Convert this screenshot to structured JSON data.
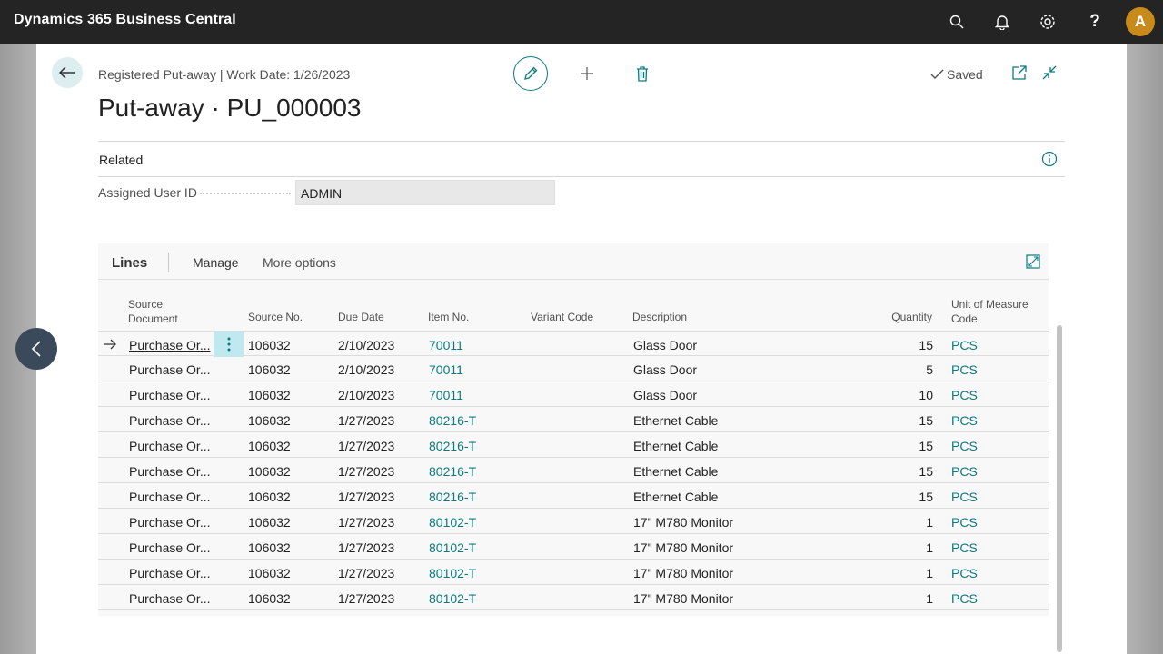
{
  "app": {
    "title": "Dynamics 365 Business Central",
    "avatar_initial": "A"
  },
  "icons": {
    "search": "search-icon",
    "bell": "bell-icon",
    "settings": "gear-icon",
    "help": "help-icon",
    "back": "back-arrow-icon",
    "edit": "pencil-icon",
    "add": "plus-icon",
    "delete": "trash-icon",
    "saved": "checkmark-icon",
    "open_new": "open-new-window-icon",
    "collapse": "collapse-icon",
    "info": "info-icon",
    "expand": "expand-icon",
    "row_arrow": "right-arrow-icon",
    "row_menu": "more-vertical-icon",
    "side_nav": "chevron-left-icon"
  },
  "colors": {
    "accent": "#0b7a80",
    "appbar": "#242424",
    "avatar": "#c88a1b"
  },
  "header": {
    "breadcrumb": "Registered Put-away | Work Date: 1/26/2023",
    "title": "Put-away · PU_000003",
    "saved_label": "Saved"
  },
  "related": {
    "label": "Related"
  },
  "fields": {
    "assigned_user_label": "Assigned User ID",
    "assigned_user_value": "ADMIN"
  },
  "lines": {
    "title": "Lines",
    "actions": {
      "manage": "Manage",
      "more_options": "More options"
    },
    "columns": {
      "source_document": "Source Document",
      "source_no": "Source No.",
      "due_date": "Due Date",
      "item_no": "Item No.",
      "variant_code": "Variant Code",
      "description": "Description",
      "quantity": "Quantity",
      "uom": "Unit of Measure Code"
    },
    "rows": [
      {
        "source_document": "Purchase Or...",
        "source_no": "106032",
        "due_date": "2/10/2023",
        "item_no": "70011",
        "variant_code": "",
        "description": "Glass Door",
        "quantity": "15",
        "uom": "PCS"
      },
      {
        "source_document": "Purchase Or...",
        "source_no": "106032",
        "due_date": "2/10/2023",
        "item_no": "70011",
        "variant_code": "",
        "description": "Glass Door",
        "quantity": "5",
        "uom": "PCS"
      },
      {
        "source_document": "Purchase Or...",
        "source_no": "106032",
        "due_date": "2/10/2023",
        "item_no": "70011",
        "variant_code": "",
        "description": "Glass Door",
        "quantity": "10",
        "uom": "PCS"
      },
      {
        "source_document": "Purchase Or...",
        "source_no": "106032",
        "due_date": "1/27/2023",
        "item_no": "80216-T",
        "variant_code": "",
        "description": "Ethernet Cable",
        "quantity": "15",
        "uom": "PCS"
      },
      {
        "source_document": "Purchase Or...",
        "source_no": "106032",
        "due_date": "1/27/2023",
        "item_no": "80216-T",
        "variant_code": "",
        "description": "Ethernet Cable",
        "quantity": "15",
        "uom": "PCS"
      },
      {
        "source_document": "Purchase Or...",
        "source_no": "106032",
        "due_date": "1/27/2023",
        "item_no": "80216-T",
        "variant_code": "",
        "description": "Ethernet Cable",
        "quantity": "15",
        "uom": "PCS"
      },
      {
        "source_document": "Purchase Or...",
        "source_no": "106032",
        "due_date": "1/27/2023",
        "item_no": "80216-T",
        "variant_code": "",
        "description": "Ethernet Cable",
        "quantity": "15",
        "uom": "PCS"
      },
      {
        "source_document": "Purchase Or...",
        "source_no": "106032",
        "due_date": "1/27/2023",
        "item_no": "80102-T",
        "variant_code": "",
        "description": "17\" M780 Monitor",
        "quantity": "1",
        "uom": "PCS"
      },
      {
        "source_document": "Purchase Or...",
        "source_no": "106032",
        "due_date": "1/27/2023",
        "item_no": "80102-T",
        "variant_code": "",
        "description": "17\" M780 Monitor",
        "quantity": "1",
        "uom": "PCS"
      },
      {
        "source_document": "Purchase Or...",
        "source_no": "106032",
        "due_date": "1/27/2023",
        "item_no": "80102-T",
        "variant_code": "",
        "description": "17\" M780 Monitor",
        "quantity": "1",
        "uom": "PCS"
      },
      {
        "source_document": "Purchase Or...",
        "source_no": "106032",
        "due_date": "1/27/2023",
        "item_no": "80102-T",
        "variant_code": "",
        "description": "17\" M780 Monitor",
        "quantity": "1",
        "uom": "PCS"
      }
    ]
  }
}
